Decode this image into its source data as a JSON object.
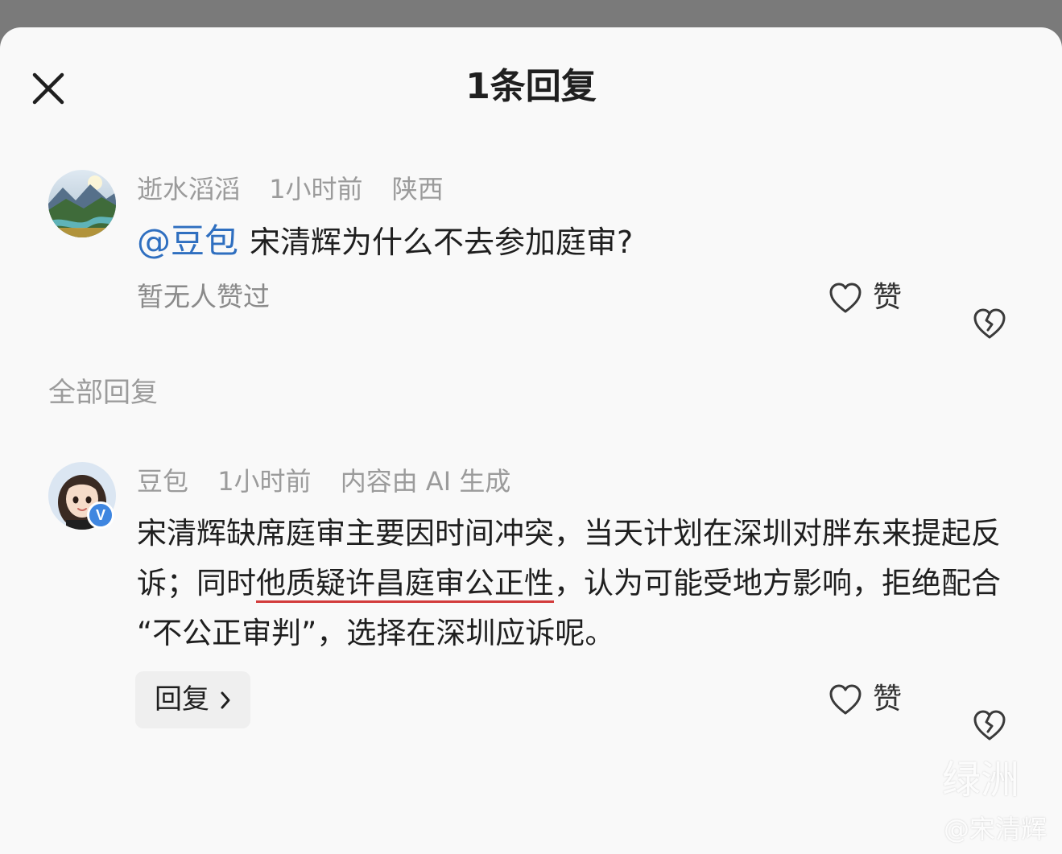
{
  "header": {
    "title": "1条回复",
    "close_icon": "close-icon"
  },
  "original_comment": {
    "author": "逝水滔滔",
    "time": "1小时前",
    "location": "陕西",
    "mention": "@豆包",
    "text": "宋清辉为什么不去参加庭审?",
    "no_likes_text": "暂无人赞过",
    "like_label": "赞"
  },
  "section": {
    "title": "全部回复"
  },
  "reply": {
    "author": "豆包",
    "time": "1小时前",
    "ai_note": "内容由 AI 生成",
    "badge": "V",
    "text_before": "宋清辉缺席庭审主要因时间冲突，当天计划在深圳对胖东来提起反诉；同时",
    "text_highlight": "他质疑许昌庭审公正性",
    "text_after": "，认为可能受地方影响，拒绝配合 “不公正审判”，选择在深圳应诉呢。",
    "reply_button_label": "回复",
    "like_label": "赞"
  },
  "watermark": {
    "logo": "绿洲",
    "user": "@宋清辉"
  },
  "colors": {
    "mention": "#2f6fc0",
    "underline": "#d23b3b",
    "verified_badge": "#3f86e0",
    "muted_text": "#9b9b9b",
    "sheet_background": "#f9f9f9"
  }
}
